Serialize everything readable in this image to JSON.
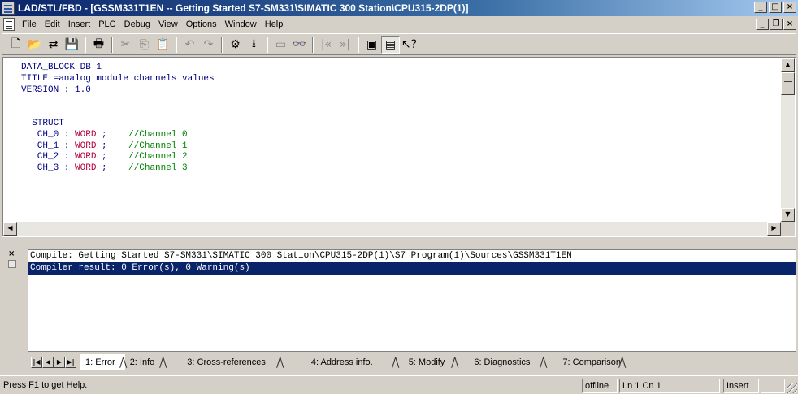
{
  "window": {
    "title": "LAD/STL/FBD  - [GSSM331T1EN -- Getting Started S7-SM331\\SIMATIC 300 Station\\CPU315-2DP(1)]",
    "app_icon": "simatic-app-icon",
    "controls": {
      "minimize": "_",
      "maximize": "□",
      "close": "×"
    }
  },
  "menu": {
    "items": [
      "File",
      "Edit",
      "Insert",
      "PLC",
      "Debug",
      "View",
      "Options",
      "Window",
      "Help"
    ],
    "mdi_controls": {
      "minimize": "_",
      "restore": "❐",
      "close": "×"
    }
  },
  "toolbar": {
    "buttons": [
      {
        "name": "new-icon",
        "glyph": "🗋",
        "enabled": true
      },
      {
        "name": "open-icon",
        "glyph": "📂",
        "enabled": true
      },
      {
        "name": "accessible-nodes-icon",
        "glyph": "⇄",
        "enabled": true
      },
      {
        "name": "save-icon",
        "glyph": "💾",
        "enabled": true
      },
      {
        "name": "print-icon",
        "glyph": "🖶",
        "enabled": true
      },
      {
        "name": "cut-icon",
        "glyph": "✂",
        "enabled": false
      },
      {
        "name": "copy-icon",
        "glyph": "⎘",
        "enabled": false
      },
      {
        "name": "paste-icon",
        "glyph": "📋",
        "enabled": true
      },
      {
        "name": "undo-icon",
        "glyph": "↶",
        "enabled": false
      },
      {
        "name": "redo-icon",
        "glyph": "↷",
        "enabled": false
      },
      {
        "name": "compile-icon",
        "glyph": "⚙",
        "enabled": true
      },
      {
        "name": "download-icon",
        "glyph": "⭳",
        "enabled": true
      },
      {
        "name": "monitor-icon",
        "glyph": "▭",
        "enabled": false
      },
      {
        "name": "glasses-icon",
        "glyph": "👓",
        "enabled": false
      },
      {
        "name": "prev-network-icon",
        "glyph": "|«",
        "enabled": false
      },
      {
        "name": "next-network-icon",
        "glyph": "»|",
        "enabled": false
      },
      {
        "name": "window-layout-icon",
        "glyph": "▣",
        "enabled": true
      },
      {
        "name": "details-view-icon",
        "glyph": "▤",
        "enabled": true,
        "pressed": true
      },
      {
        "name": "help-icon",
        "glyph": "↖?",
        "enabled": true
      }
    ]
  },
  "editor": {
    "lines": [
      [
        {
          "t": "DATA_BLOCK DB 1",
          "c": "kw"
        }
      ],
      [
        {
          "t": "TITLE =analog module channels values",
          "c": "kw"
        }
      ],
      [
        {
          "t": "VERSION : 1.0",
          "c": "kw"
        }
      ],
      [
        {
          "t": "",
          "c": "kw"
        }
      ],
      [
        {
          "t": "",
          "c": "kw"
        }
      ],
      [
        {
          "t": "  STRUCT",
          "c": "kw"
        }
      ],
      [
        {
          "t": "   CH_0 : ",
          "c": "kw"
        },
        {
          "t": "WORD",
          "c": "ty"
        },
        {
          "t": " ;    ",
          "c": "kw"
        },
        {
          "t": "//Channel 0",
          "c": "cm"
        }
      ],
      [
        {
          "t": "   CH_1 : ",
          "c": "kw"
        },
        {
          "t": "WORD",
          "c": "ty"
        },
        {
          "t": " ;    ",
          "c": "kw"
        },
        {
          "t": "//Channel 1",
          "c": "cm"
        }
      ],
      [
        {
          "t": "   CH_2 : ",
          "c": "kw"
        },
        {
          "t": "WORD",
          "c": "ty"
        },
        {
          "t": " ;    ",
          "c": "kw"
        },
        {
          "t": "//Channel 2",
          "c": "cm"
        }
      ],
      [
        {
          "t": "   CH_3 : ",
          "c": "kw"
        },
        {
          "t": "WORD",
          "c": "ty"
        },
        {
          "t": " ;    ",
          "c": "kw"
        },
        {
          "t": "//Channel 3",
          "c": "cm"
        }
      ]
    ]
  },
  "output": {
    "lines": [
      {
        "text": "Compile: Getting Started S7-SM331\\SIMATIC 300 Station\\CPU315-2DP(1)\\S7 Program(1)\\Sources\\GSSM331T1EN",
        "selected": false
      },
      {
        "text": "Compiler result: 0 Error(s), 0 Warning(s)",
        "selected": true
      }
    ],
    "tabs": [
      "1: Error",
      "2: Info",
      "3: Cross-references",
      "4: Address info.",
      "5: Modify",
      "6: Diagnostics",
      "7: Comparison"
    ],
    "active_tab": 0
  },
  "status": {
    "message": "Press F1 to get Help.",
    "mode": "offline",
    "position": "Ln 1 Cn 1",
    "insert": "Insert"
  }
}
